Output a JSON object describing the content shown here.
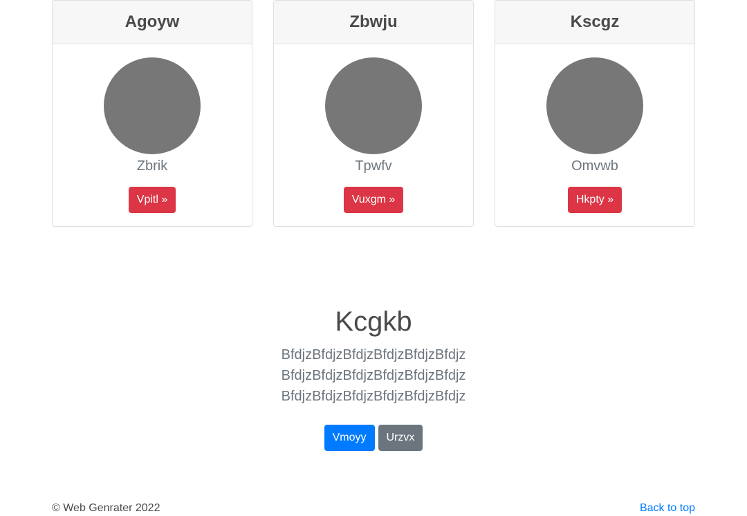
{
  "cards": [
    {
      "title": "Agoyw",
      "subtitle": "Zbrik",
      "button": "Vpitl »"
    },
    {
      "title": "Zbwju",
      "subtitle": "Tpwfv",
      "button": "Vuxgm »"
    },
    {
      "title": "Kscgz",
      "subtitle": "Omvwb",
      "button": "Hkpty »"
    }
  ],
  "hero": {
    "title": "Kcgkb",
    "lead": "BfdjzBfdjzBfdjzBfdjzBfdjzBfdjz BfdjzBfdjzBfdjzBfdjzBfdjzBfdjz BfdjzBfdjzBfdjzBfdjzBfdjzBfdjz",
    "primary_button": "Vmoyy",
    "secondary_button": "Urzvx"
  },
  "footer": {
    "copyright": "© Web Genrater 2022",
    "back_to_top": "Back to top"
  },
  "colors": {
    "danger": "#dc3545",
    "primary": "#007bff",
    "secondary": "#6c757d",
    "avatar": "#777777"
  }
}
